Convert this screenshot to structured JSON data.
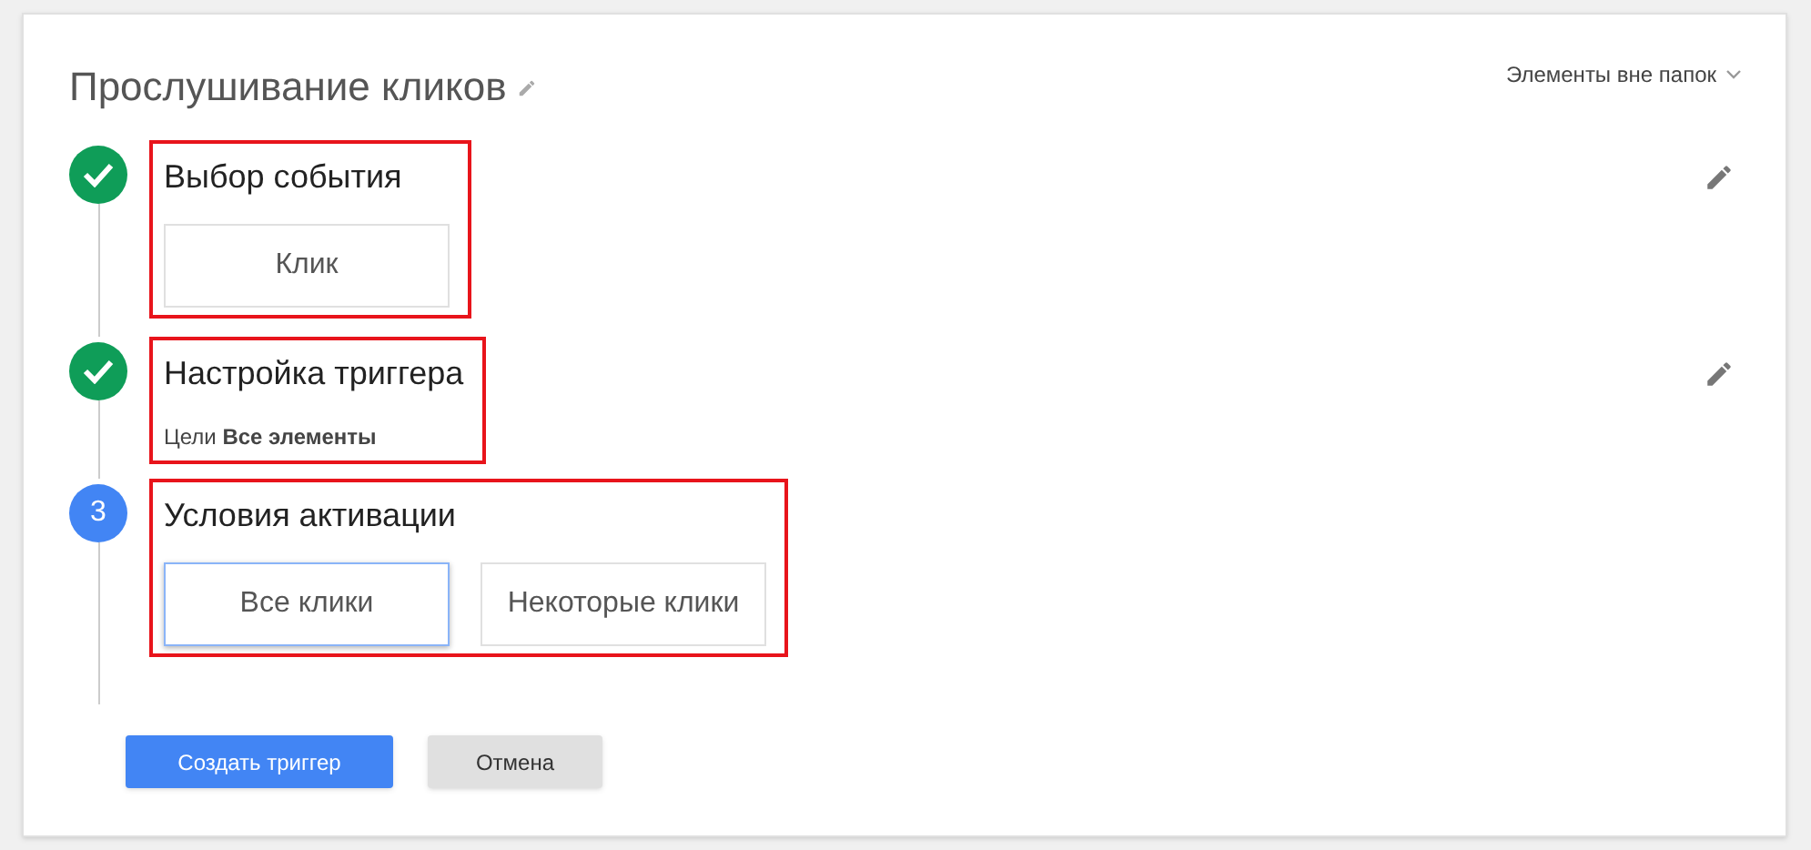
{
  "title": "Прослушивание кликов",
  "folder_dropdown": {
    "label": "Элементы вне папок"
  },
  "steps": [
    {
      "title": "Выбор события",
      "completed": true,
      "highlighted": true,
      "kind": "options",
      "options": [
        {
          "label": "Клик",
          "selected": false
        }
      ]
    },
    {
      "title": "Настройка триггера",
      "completed": true,
      "highlighted": true,
      "kind": "summary",
      "summary": "Цели **Все элементы**"
    },
    {
      "title": "Условия активации",
      "number": "3",
      "completed": false,
      "highlighted": true,
      "kind": "options",
      "options": [
        {
          "label": "Все клики",
          "selected": true
        },
        {
          "label": "Некоторые клики",
          "selected": false
        }
      ]
    }
  ],
  "buttons": [
    {
      "label": "Создать триггер",
      "kind": "primary"
    },
    {
      "label": "Отмена",
      "kind": "secondary"
    }
  ]
}
